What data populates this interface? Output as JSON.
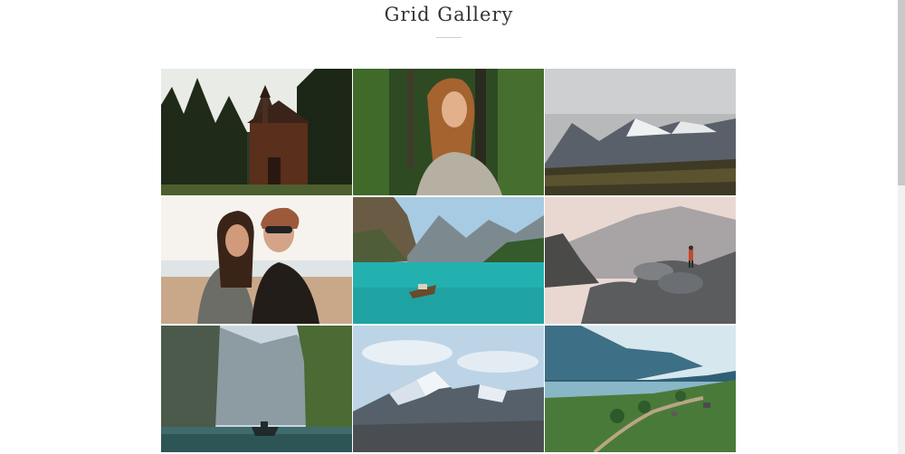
{
  "page": {
    "title": "Grid Gallery"
  },
  "gallery": {
    "tiles": [
      {
        "subject": "forest-chapel"
      },
      {
        "subject": "woman-in-forest"
      },
      {
        "subject": "misty-mountains"
      },
      {
        "subject": "two-friends-beach"
      },
      {
        "subject": "turquoise-lake-boat"
      },
      {
        "subject": "hiker-on-rocks"
      },
      {
        "subject": "fjord-cliffs-boat"
      },
      {
        "subject": "snowy-peaks"
      },
      {
        "subject": "river-valley-village"
      }
    ]
  },
  "colors": {
    "background": "#ffffff",
    "title": "#333333",
    "rule": "#cfcfcf"
  }
}
